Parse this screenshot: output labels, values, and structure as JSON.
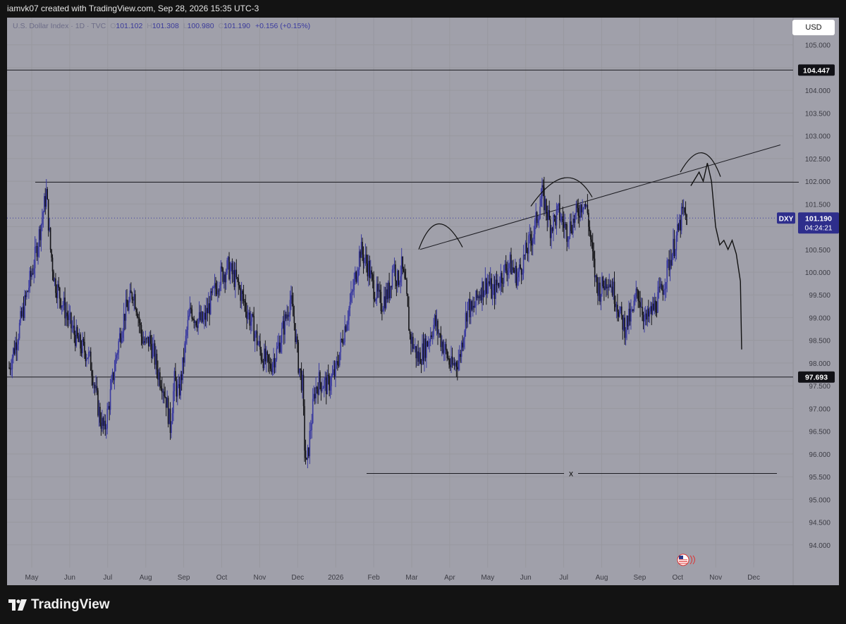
{
  "header": {
    "text": "iamvk07 created with TradingView.com, Sep 28, 2026 15:35 UTC-3"
  },
  "legend": {
    "symbol_line": "U.S. Dollar Index · 1D · TVC",
    "open_label": "O",
    "open": "101.102",
    "high_label": "H",
    "high": "101.308",
    "low_label": "L",
    "low": "100.980",
    "close_label": "C",
    "close": "101.190",
    "change": "+0.156 (+0.15%)"
  },
  "currency_button": {
    "label": "USD"
  },
  "footer": {
    "brand": "TradingView"
  },
  "colors": {
    "background": "#a0a0aa",
    "up_candle": "#3a3aa0",
    "down_candle": "#141418",
    "tag_blue": "#2e2e8c"
  },
  "chart_data": {
    "type": "candlestick",
    "symbol": "DXY",
    "interval": "1D",
    "x_tick_labels": [
      "May",
      "Jun",
      "Jul",
      "Aug",
      "Sep",
      "Oct",
      "Nov",
      "Dec",
      "2026",
      "Feb",
      "Mar",
      "Apr",
      "May",
      "Jun",
      "Jul",
      "Aug",
      "Sep",
      "Oct",
      "Nov",
      "Dec"
    ],
    "y_tick_labels": [
      "105.000",
      "104.500",
      "104.000",
      "103.500",
      "103.000",
      "102.500",
      "102.000",
      "101.500",
      "101.000",
      "100.500",
      "100.000",
      "99.500",
      "99.000",
      "98.500",
      "98.000",
      "97.500",
      "97.000",
      "96.500",
      "96.000",
      "95.500",
      "95.000",
      "94.500",
      "94.000"
    ],
    "ylim": [
      93.5,
      105.6
    ],
    "horizontal_levels": [
      {
        "value": 104.447,
        "label": "104.447"
      },
      {
        "value": 97.693,
        "label": "97.693"
      }
    ],
    "resistance_level": 101.98,
    "support_x_level": {
      "value": 95.57,
      "label": "x"
    },
    "last_price": {
      "tag": "DXY",
      "value": "101.190",
      "countdown": "04:24:21"
    },
    "price_path": [
      [
        0,
        97.9
      ],
      [
        2,
        98.6
      ],
      [
        4,
        99.4
      ],
      [
        6,
        100.2
      ],
      [
        8,
        101.2
      ],
      [
        9,
        101.75
      ],
      [
        10,
        100.5
      ],
      [
        11,
        99.8
      ],
      [
        13,
        99.3
      ],
      [
        15,
        98.8
      ],
      [
        17,
        98.4
      ],
      [
        19,
        98.2
      ],
      [
        20,
        97.9
      ],
      [
        21,
        97.3
      ],
      [
        22,
        96.8
      ],
      [
        23,
        96.5
      ],
      [
        24,
        97.0
      ],
      [
        25,
        97.6
      ],
      [
        26,
        98.2
      ],
      [
        27,
        98.7
      ],
      [
        28,
        99.1
      ],
      [
        29,
        99.3
      ],
      [
        30,
        99.6
      ],
      [
        31,
        99.2
      ],
      [
        32,
        98.6
      ],
      [
        33,
        98.4
      ],
      [
        34,
        98.5
      ],
      [
        35,
        98.2
      ],
      [
        36,
        97.8
      ],
      [
        37,
        97.6
      ],
      [
        38,
        97.2
      ],
      [
        39,
        96.6
      ],
      [
        40,
        97.6
      ],
      [
        41,
        97.3
      ],
      [
        42,
        97.9
      ],
      [
        43,
        98.7
      ],
      [
        44,
        99.2
      ],
      [
        45,
        99.0
      ],
      [
        47,
        98.9
      ],
      [
        49,
        99.4
      ],
      [
        51,
        99.9
      ],
      [
        53,
        100.1
      ],
      [
        55,
        99.8
      ],
      [
        57,
        99.3
      ],
      [
        59,
        98.8
      ],
      [
        61,
        98.2
      ],
      [
        63,
        97.9
      ],
      [
        65,
        98.3
      ],
      [
        67,
        99.0
      ],
      [
        68,
        99.4
      ],
      [
        69,
        98.9
      ],
      [
        70,
        98.0
      ],
      [
        71,
        97.5
      ],
      [
        71.5,
        96.2
      ],
      [
        72,
        95.7
      ],
      [
        73,
        96.6
      ],
      [
        74,
        97.4
      ],
      [
        75,
        97.6
      ],
      [
        77,
        97.5
      ],
      [
        79,
        97.8
      ],
      [
        81,
        98.7
      ],
      [
        83,
        99.5
      ],
      [
        85,
        100.5
      ],
      [
        87,
        100.1
      ],
      [
        88,
        99.7
      ],
      [
        90,
        99.3
      ],
      [
        92,
        99.6
      ],
      [
        93,
        100.2
      ],
      [
        94,
        99.8
      ],
      [
        95,
        100.1
      ],
      [
        96,
        99.6
      ],
      [
        97,
        98.6
      ],
      [
        99,
        98.1
      ],
      [
        101,
        98.4
      ],
      [
        103,
        98.9
      ],
      [
        105,
        98.4
      ],
      [
        107,
        97.9
      ],
      [
        109,
        98.1
      ],
      [
        110,
        98.7
      ],
      [
        111,
        99.3
      ],
      [
        112,
        99.1
      ],
      [
        114,
        99.6
      ],
      [
        116,
        99.8
      ],
      [
        117,
        99.5
      ],
      [
        119,
        99.9
      ],
      [
        121,
        100.2
      ],
      [
        123,
        99.9
      ],
      [
        125,
        100.4
      ],
      [
        127,
        100.9
      ],
      [
        128,
        101.3
      ],
      [
        129,
        101.7
      ],
      [
        130,
        101.4
      ],
      [
        131,
        101.0
      ],
      [
        133,
        101.3
      ],
      [
        135,
        100.9
      ],
      [
        137,
        101.2
      ],
      [
        139,
        101.6
      ],
      [
        140,
        101.3
      ],
      [
        141,
        100.5
      ],
      [
        142,
        99.8
      ],
      [
        143,
        99.6
      ],
      [
        145,
        99.9
      ],
      [
        147,
        99.4
      ],
      [
        148,
        99.0
      ],
      [
        149,
        98.8
      ],
      [
        151,
        99.1
      ],
      [
        152,
        99.6
      ],
      [
        153,
        99.3
      ],
      [
        154,
        98.9
      ],
      [
        156,
        99.2
      ],
      [
        158,
        99.6
      ],
      [
        160,
        100.3
      ],
      [
        162,
        100.9
      ],
      [
        163,
        101.3
      ],
      [
        164,
        101.2
      ]
    ],
    "drawn_projection": [
      [
        165,
        101.9
      ],
      [
        167,
        102.2
      ],
      [
        168,
        102.0
      ],
      [
        169,
        102.4
      ],
      [
        170,
        102.0
      ],
      [
        171,
        101.0
      ],
      [
        172,
        100.6
      ],
      [
        173,
        100.7
      ],
      [
        174,
        100.5
      ],
      [
        175,
        100.7
      ],
      [
        176,
        100.4
      ],
      [
        177,
        99.8
      ],
      [
        177.3,
        98.3
      ]
    ]
  }
}
